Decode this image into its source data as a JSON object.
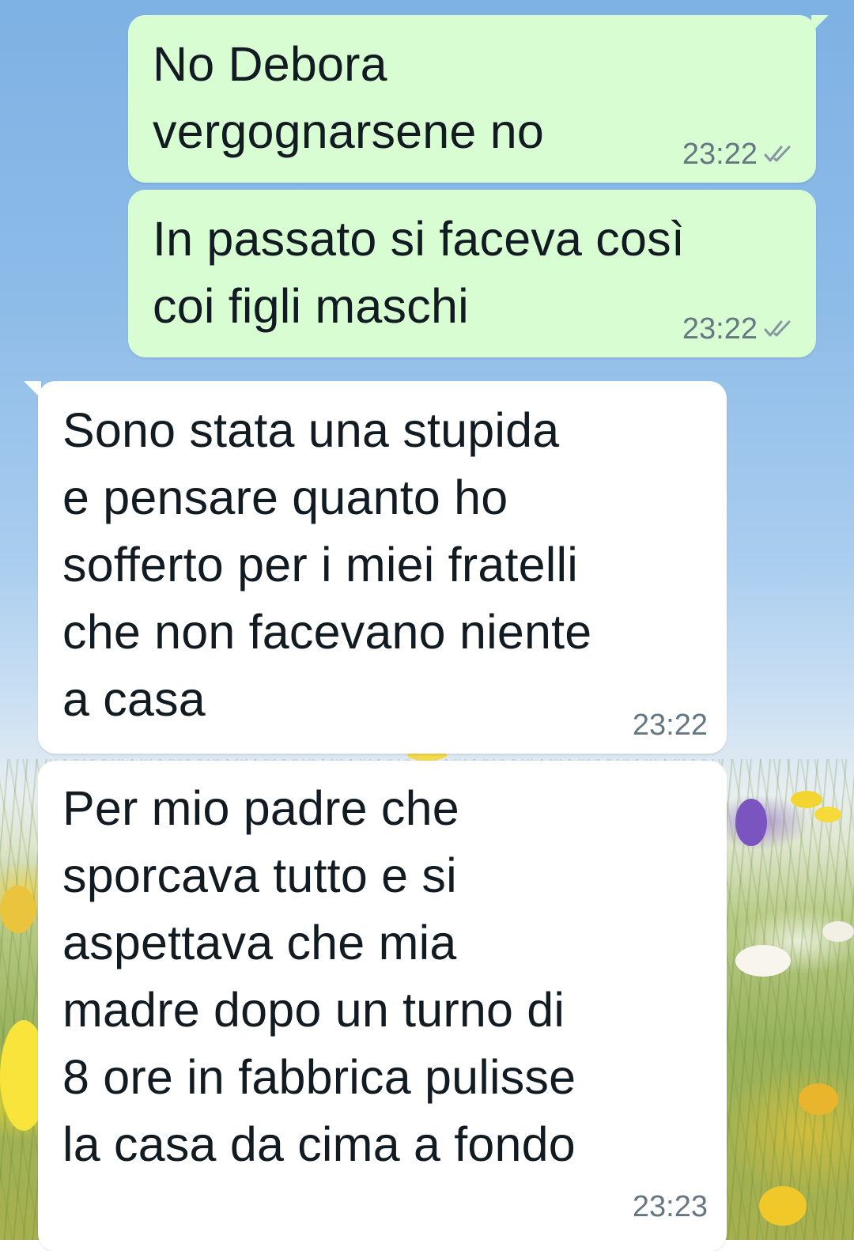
{
  "messages": [
    {
      "direction": "outgoing",
      "text": "No Debora\nvergognarsene no",
      "time": "23:22",
      "status_icon": "double-check-icon"
    },
    {
      "direction": "outgoing",
      "text": "In passato si faceva così\ncoi figli maschi",
      "time": "23:22",
      "status_icon": "double-check-icon"
    },
    {
      "direction": "incoming",
      "text": "Sono stata una stupida\ne pensare quanto ho\nsofferto per i miei fratelli\nche non facevano niente\na casa",
      "time": "23:22"
    },
    {
      "direction": "incoming",
      "text": "Per mio padre che\nsporcava tutto e si\naspettava che mia\nmadre dopo un turno di\n8 ore in fabbrica pulisse\nla casa da cima a fondo",
      "time": "23:23"
    }
  ],
  "colors": {
    "outgoing_bubble": "#d9fdd3",
    "incoming_bubble": "#ffffff",
    "message_text": "#111b21",
    "meta_text": "#667781"
  }
}
